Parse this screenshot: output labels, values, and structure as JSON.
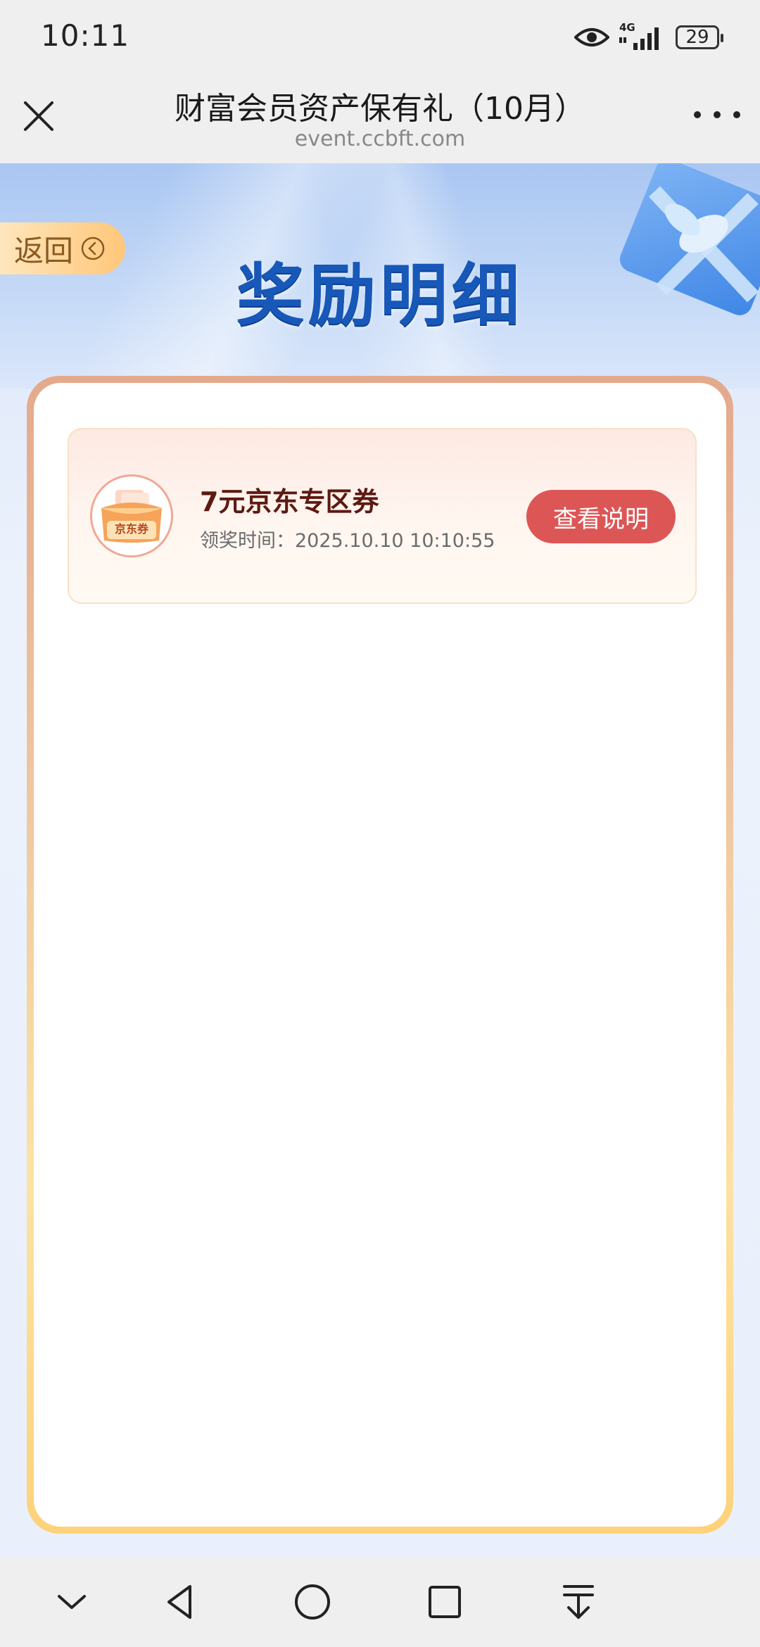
{
  "status_bar": {
    "time": "10:11",
    "network": "4G",
    "battery": "29",
    "icons": [
      "eye-icon",
      "signal-icon",
      "battery-icon"
    ]
  },
  "title_bar": {
    "title": "财富会员资产保有礼（10月）",
    "url": "event.ccbft.com",
    "icons": [
      "close-icon",
      "more-icon"
    ]
  },
  "hero": {
    "back_label": "返回",
    "title": "奖励明细"
  },
  "rewards": [
    {
      "badge": "京东券",
      "name": "7元京东专区券",
      "time_label": "领奖时间：",
      "time": "2025.10.10 10:10:55",
      "action": "查看说明"
    }
  ],
  "nav_bar": {
    "icons": [
      "chevron-down-icon",
      "back-triangle-icon",
      "home-circle-icon",
      "recents-square-icon",
      "download-icon"
    ]
  },
  "colors": {
    "accent_blue": "#1758b8",
    "button_red": "#dd5656",
    "reward_text": "#5c1a12"
  }
}
